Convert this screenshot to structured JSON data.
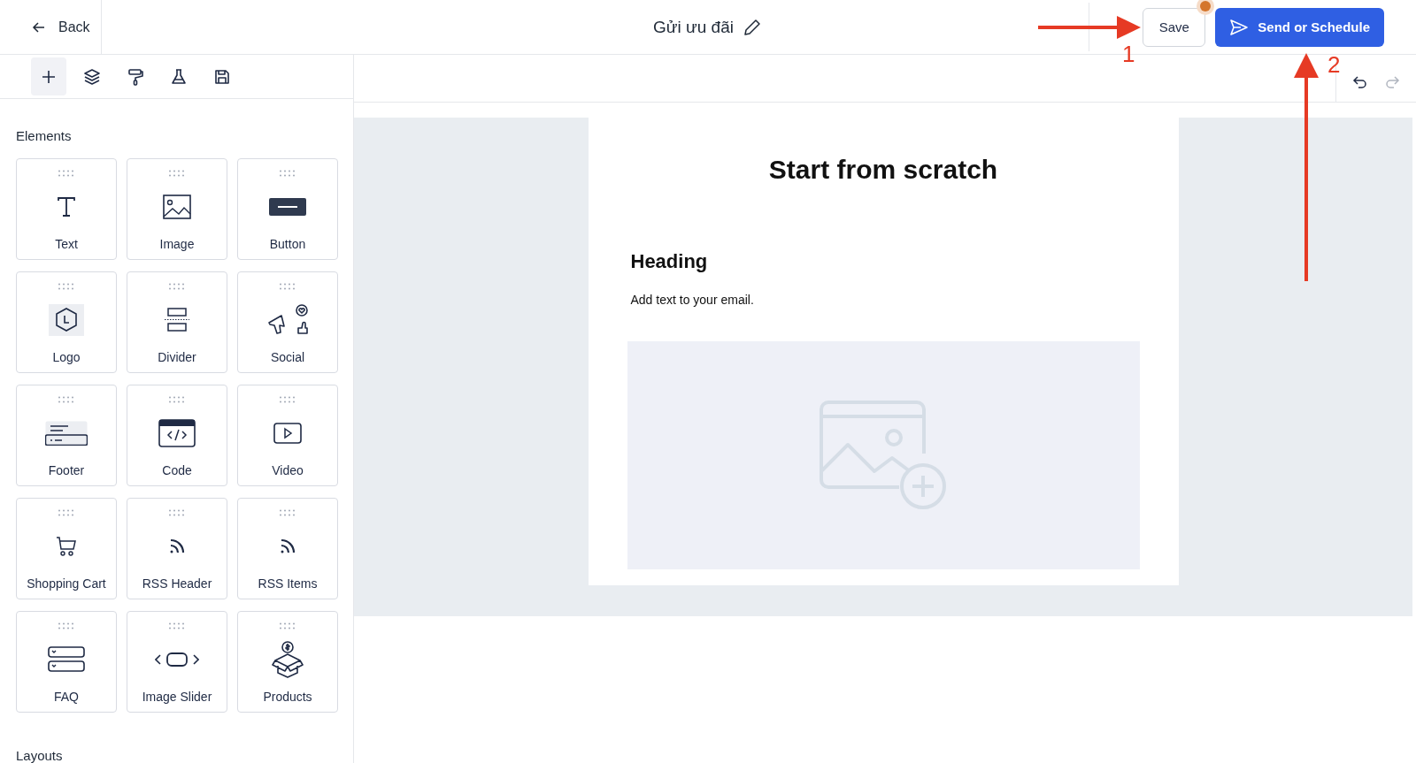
{
  "header": {
    "back": "Back",
    "title": "Gửi ưu đãi",
    "save": "Save",
    "unsaved": true,
    "send": "Send or Schedule"
  },
  "tools": [
    {
      "kind": "add",
      "selected": true
    },
    {
      "kind": "layers",
      "selected": false
    },
    {
      "kind": "paint",
      "selected": false
    },
    {
      "kind": "test",
      "selected": false
    },
    {
      "kind": "save",
      "selected": false
    }
  ],
  "history": {
    "undo_disabled": false,
    "redo_disabled": true
  },
  "sidebar": {
    "heading": "Elements",
    "items": [
      {
        "label": "Text",
        "kind": "text"
      },
      {
        "label": "Image",
        "kind": "image"
      },
      {
        "label": "Button",
        "kind": "button"
      },
      {
        "label": "Logo",
        "kind": "logo"
      },
      {
        "label": "Divider",
        "kind": "divider"
      },
      {
        "label": "Social",
        "kind": "social"
      },
      {
        "label": "Footer",
        "kind": "footer"
      },
      {
        "label": "Code",
        "kind": "code"
      },
      {
        "label": "Video",
        "kind": "video"
      },
      {
        "label": "Shopping Cart",
        "kind": "cart"
      },
      {
        "label": "RSS Header",
        "kind": "rss"
      },
      {
        "label": "RSS Items",
        "kind": "rss"
      },
      {
        "label": "FAQ",
        "kind": "faq"
      },
      {
        "label": "Image Slider",
        "kind": "slider"
      },
      {
        "label": "Products",
        "kind": "products"
      }
    ],
    "section": "Layouts"
  },
  "email": {
    "title": "Start from scratch",
    "heading": "Heading",
    "body": "Add text to your email."
  },
  "annotations": [
    "1",
    "2"
  ]
}
